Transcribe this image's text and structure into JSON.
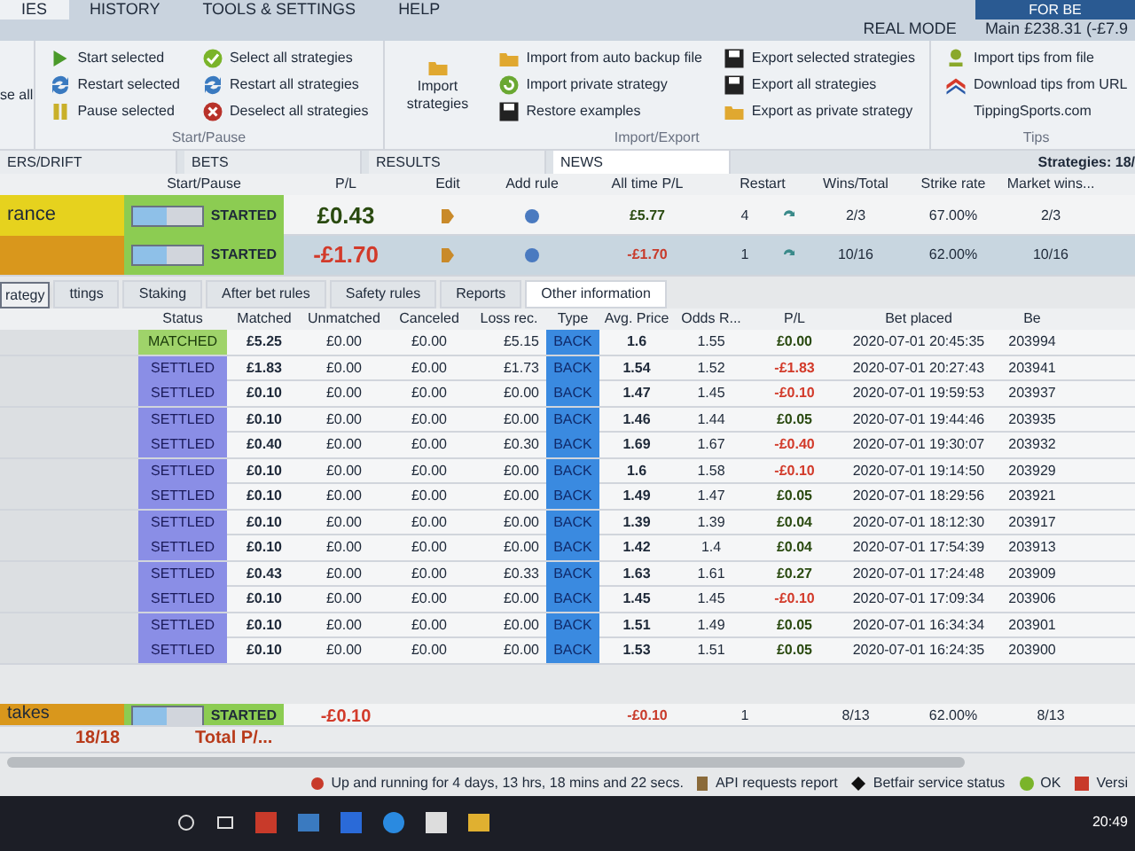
{
  "menu": {
    "tabs": [
      {
        "label": "IES",
        "selected": true
      },
      {
        "label": "HISTORY",
        "selected": false
      },
      {
        "label": "TOOLS & SETTINGS",
        "selected": false
      },
      {
        "label": "HELP",
        "selected": false
      }
    ],
    "banner": "FOR BE",
    "mode": "REAL MODE",
    "balance": "Main £238.31 (-£7.9"
  },
  "ribbon": {
    "partial_button": "se all",
    "groups": [
      {
        "label": "Start/Pause",
        "columns": [
          [
            "Start selected",
            "Restart selected",
            "Pause selected"
          ],
          [
            "Select all strategies",
            "Restart all strategies",
            "Deselect all strategies"
          ]
        ]
      },
      {
        "label": "Import/Export",
        "big": "Import strategies",
        "columns": [
          [
            "Import from auto backup file",
            "Import private strategy",
            "Restore examples"
          ],
          [
            "Export selected strategies",
            "Export all strategies",
            "Export as private strategy"
          ]
        ]
      },
      {
        "label": "Tips",
        "columns": [
          [
            "Import tips from file",
            "Download tips from URL",
            "TippingSports.com"
          ]
        ]
      }
    ]
  },
  "view_tabs": [
    {
      "label": "ERS/DRIFT",
      "selected": false
    },
    {
      "label": "BETS",
      "selected": false
    },
    {
      "label": "RESULTS",
      "selected": false
    },
    {
      "label": "NEWS",
      "selected": true
    }
  ],
  "strategies": {
    "count": "Strategies: 18/",
    "columns": [
      "Start/Pause",
      "P/L",
      "Edit",
      "Add rule",
      "All time P/L",
      "Restart",
      "Wins/Total",
      "Strike rate",
      "Market wins..."
    ],
    "rows": [
      {
        "name": "rance",
        "color": "#e6d21e",
        "on": true,
        "status": "STARTED",
        "pl": "£0.43",
        "loss": false,
        "all_time": "£5.77",
        "all_time_loss": false,
        "restart": "4",
        "wins": "2/3",
        "strike": "67.00%",
        "market": "2/3",
        "selected": false
      },
      {
        "name": "",
        "color": "#d9971c",
        "on": true,
        "status": "STARTED",
        "pl": "-£1.70",
        "loss": true,
        "all_time": "-£1.70",
        "all_time_loss": true,
        "restart": "1",
        "wins": "10/16",
        "strike": "62.00%",
        "market": "10/16",
        "selected": true
      }
    ]
  },
  "popup_label": "rategy",
  "detail_tabs": [
    {
      "label": "ttings",
      "selected": false
    },
    {
      "label": "Staking",
      "selected": false
    },
    {
      "label": "After bet rules",
      "selected": false
    },
    {
      "label": "Safety rules",
      "selected": false
    },
    {
      "label": "Reports",
      "selected": false
    },
    {
      "label": "Other information",
      "selected": true
    }
  ],
  "bets": {
    "columns": [
      "Status",
      "Matched",
      "Unmatched",
      "Canceled",
      "Loss rec.",
      "Type",
      "Avg. Price",
      "Odds R...",
      "P/L",
      "Bet placed",
      "Be"
    ],
    "rows": [
      {
        "status": "MATCHED",
        "kind": "matched",
        "matched": "£5.25",
        "unmatched": "£0.00",
        "canceled": "£0.00",
        "loss_rec": "£5.15",
        "type": "BACK",
        "avg": "1.6",
        "odds": "1.55",
        "pl": "£0.00",
        "loss": false,
        "placed": "2020-07-01 20:45:35",
        "id": "203994"
      },
      {
        "status": "SETTLED",
        "kind": "settled",
        "matched": "£1.83",
        "unmatched": "£0.00",
        "canceled": "£0.00",
        "loss_rec": "£1.73",
        "type": "BACK",
        "avg": "1.54",
        "odds": "1.52",
        "pl": "-£1.83",
        "loss": true,
        "placed": "2020-07-01 20:27:43",
        "id": "203941"
      },
      {
        "status": "SETTLED",
        "kind": "settled",
        "matched": "£0.10",
        "unmatched": "£0.00",
        "canceled": "£0.00",
        "loss_rec": "£0.00",
        "type": "BACK",
        "avg": "1.47",
        "odds": "1.45",
        "pl": "-£0.10",
        "loss": true,
        "placed": "2020-07-01 19:59:53",
        "id": "203937"
      },
      {
        "status": "SETTLED",
        "kind": "settled",
        "matched": "£0.10",
        "unmatched": "£0.00",
        "canceled": "£0.00",
        "loss_rec": "£0.00",
        "type": "BACK",
        "avg": "1.46",
        "odds": "1.44",
        "pl": "£0.05",
        "loss": false,
        "placed": "2020-07-01 19:44:46",
        "id": "203935"
      },
      {
        "status": "SETTLED",
        "kind": "settled",
        "matched": "£0.40",
        "unmatched": "£0.00",
        "canceled": "£0.00",
        "loss_rec": "£0.30",
        "type": "BACK",
        "avg": "1.69",
        "odds": "1.67",
        "pl": "-£0.40",
        "loss": true,
        "placed": "2020-07-01 19:30:07",
        "id": "203932"
      },
      {
        "status": "SETTLED",
        "kind": "settled",
        "matched": "£0.10",
        "unmatched": "£0.00",
        "canceled": "£0.00",
        "loss_rec": "£0.00",
        "type": "BACK",
        "avg": "1.6",
        "odds": "1.58",
        "pl": "-£0.10",
        "loss": true,
        "placed": "2020-07-01 19:14:50",
        "id": "203929"
      },
      {
        "status": "SETTLED",
        "kind": "settled",
        "matched": "£0.10",
        "unmatched": "£0.00",
        "canceled": "£0.00",
        "loss_rec": "£0.00",
        "type": "BACK",
        "avg": "1.49",
        "odds": "1.47",
        "pl": "£0.05",
        "loss": false,
        "placed": "2020-07-01 18:29:56",
        "id": "203921"
      },
      {
        "status": "SETTLED",
        "kind": "settled",
        "matched": "£0.10",
        "unmatched": "£0.00",
        "canceled": "£0.00",
        "loss_rec": "£0.00",
        "type": "BACK",
        "avg": "1.39",
        "odds": "1.39",
        "pl": "£0.04",
        "loss": false,
        "placed": "2020-07-01 18:12:30",
        "id": "203917"
      },
      {
        "status": "SETTLED",
        "kind": "settled",
        "matched": "£0.10",
        "unmatched": "£0.00",
        "canceled": "£0.00",
        "loss_rec": "£0.00",
        "type": "BACK",
        "avg": "1.42",
        "odds": "1.4",
        "pl": "£0.04",
        "loss": false,
        "placed": "2020-07-01 17:54:39",
        "id": "203913"
      },
      {
        "status": "SETTLED",
        "kind": "settled",
        "matched": "£0.43",
        "unmatched": "£0.00",
        "canceled": "£0.00",
        "loss_rec": "£0.33",
        "type": "BACK",
        "avg": "1.63",
        "odds": "1.61",
        "pl": "£0.27",
        "loss": false,
        "placed": "2020-07-01 17:24:48",
        "id": "203909"
      },
      {
        "status": "SETTLED",
        "kind": "settled",
        "matched": "£0.10",
        "unmatched": "£0.00",
        "canceled": "£0.00",
        "loss_rec": "£0.00",
        "type": "BACK",
        "avg": "1.45",
        "odds": "1.45",
        "pl": "-£0.10",
        "loss": true,
        "placed": "2020-07-01 17:09:34",
        "id": "203906"
      },
      {
        "status": "SETTLED",
        "kind": "settled",
        "matched": "£0.10",
        "unmatched": "£0.00",
        "canceled": "£0.00",
        "loss_rec": "£0.00",
        "type": "BACK",
        "avg": "1.51",
        "odds": "1.49",
        "pl": "£0.05",
        "loss": false,
        "placed": "2020-07-01 16:34:34",
        "id": "203901"
      },
      {
        "status": "SETTLED",
        "kind": "settled",
        "matched": "£0.10",
        "unmatched": "£0.00",
        "canceled": "£0.00",
        "loss_rec": "£0.00",
        "type": "BACK",
        "avg": "1.53",
        "odds": "1.51",
        "pl": "£0.05",
        "loss": false,
        "placed": "2020-07-01 16:24:35",
        "id": "203900"
      }
    ]
  },
  "strategy_row_below": {
    "name": "takes",
    "color": "#d9971c",
    "on": true,
    "status": "STARTED",
    "pl": "-£0.10",
    "all_time": "-£0.10",
    "restart": "1",
    "wins": "8/13",
    "strike": "62.00%",
    "market": "8/13"
  },
  "totals": {
    "count": "18/18",
    "label": "Total P/..."
  },
  "status_bar": {
    "uptime": "Up and running for 4 days, 13 hrs, 18 mins and 22 secs.",
    "api": "API requests report",
    "service": "Betfair service status",
    "ok": "OK",
    "version": "Versi"
  },
  "taskbar": {
    "time": "20:49"
  }
}
